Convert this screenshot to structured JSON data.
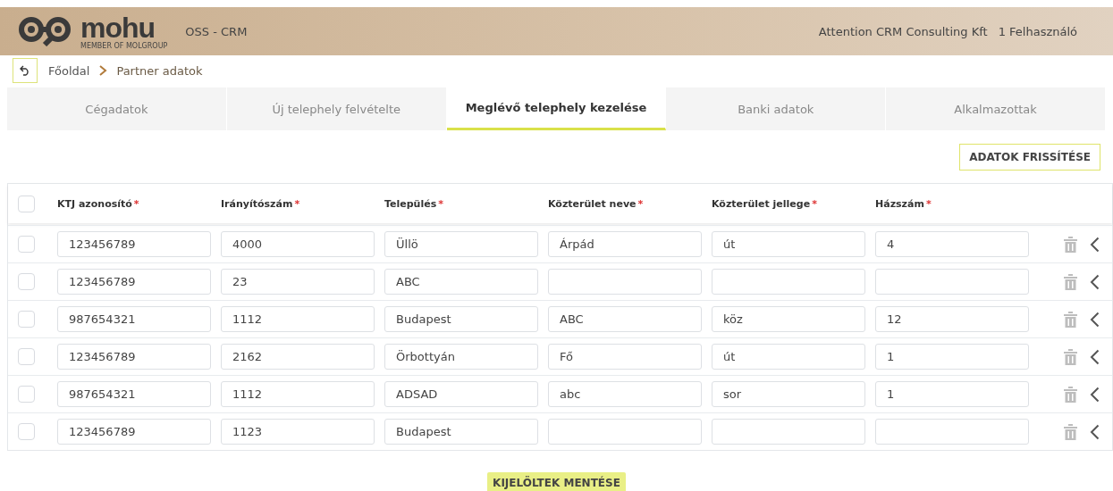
{
  "header": {
    "brand": "mohu",
    "brand_tagline": "MEMBER OF MOLGROUP",
    "app_name": "OSS - CRM",
    "company": "Attention CRM Consulting Kft",
    "user": "1 Felhasználó"
  },
  "breadcrumb": [
    "Főoldal",
    "Partner adatok"
  ],
  "tabs": [
    {
      "label": "Cégadatok",
      "selected": false
    },
    {
      "label": "Új telephely felvételte",
      "selected": false
    },
    {
      "label": "Meglévő telephely kezelése",
      "selected": true
    },
    {
      "label": "Banki adatok",
      "selected": false
    },
    {
      "label": "Alkalmazottak",
      "selected": false
    }
  ],
  "refresh_button": "ADATOK FRISSÍTÉSE",
  "table": {
    "select_all_checked": false,
    "columns": [
      {
        "label": "KTJ azonosító",
        "mark": "*"
      },
      {
        "label": "Irányítószám",
        "mark": "*"
      },
      {
        "label": "Település",
        "mark": "*"
      },
      {
        "label": "Közterület neve",
        "mark": "*"
      },
      {
        "label": "Közterület jellege",
        "mark": "*"
      },
      {
        "label": "Házszám",
        "mark": "*"
      }
    ],
    "rows": [
      {
        "checked": false,
        "cells": [
          "123456789",
          "4000",
          "Üllö",
          "Árpád",
          "út",
          "4"
        ]
      },
      {
        "checked": false,
        "cells": [
          "123456789",
          "23",
          "ABC",
          null,
          null,
          null
        ]
      },
      {
        "checked": false,
        "cells": [
          "987654321",
          "1112",
          "Budapest",
          "ABC",
          "köz",
          "12"
        ]
      },
      {
        "checked": false,
        "cells": [
          "123456789",
          "2162",
          "Örbottyán",
          "Fő",
          "út",
          "1"
        ]
      },
      {
        "checked": false,
        "cells": [
          "987654321",
          "1112",
          "ADSAD",
          "abc",
          "sor",
          "1"
        ]
      },
      {
        "checked": false,
        "cells": [
          "123456789",
          "1123",
          "Budapest",
          null,
          null,
          null
        ]
      }
    ]
  },
  "save_button": "KIJELÖLTEK MENTÉSE"
}
